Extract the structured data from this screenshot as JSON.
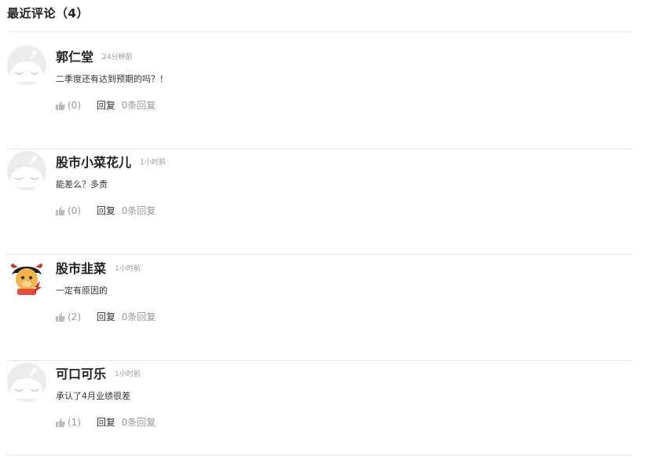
{
  "section": {
    "title": "最近评论（4）"
  },
  "comments": [
    {
      "author": "郭仁堂",
      "time": "24分钟前",
      "text": "二季度还有达到预期的吗？！",
      "like_count": "(0)",
      "reply_label": "回复",
      "reply_count": "0条回复",
      "avatar": "default-cat-avatar"
    },
    {
      "author": "股市小菜花儿",
      "time": "1小时前",
      "text": "能差么？多贵",
      "like_count": "(0)",
      "reply_label": "回复",
      "reply_count": "0条回复",
      "avatar": "default-cat-avatar"
    },
    {
      "author": "股市韭菜",
      "time": "1小时前",
      "text": "一定有原因的",
      "like_count": "(2)",
      "reply_label": "回复",
      "reply_count": "0条回复",
      "avatar": "bull-mascot-avatar"
    },
    {
      "author": "可口可乐",
      "time": "1小时前",
      "text": "承认了4月业绩很差",
      "like_count": "(1)",
      "reply_label": "回复",
      "reply_count": "0条回复",
      "avatar": "default-cat-avatar"
    }
  ],
  "colors": {
    "divider": "#e6e6e6",
    "muted_text": "#999999",
    "main_text": "#333333",
    "like_icon": "#bbbbbb"
  }
}
